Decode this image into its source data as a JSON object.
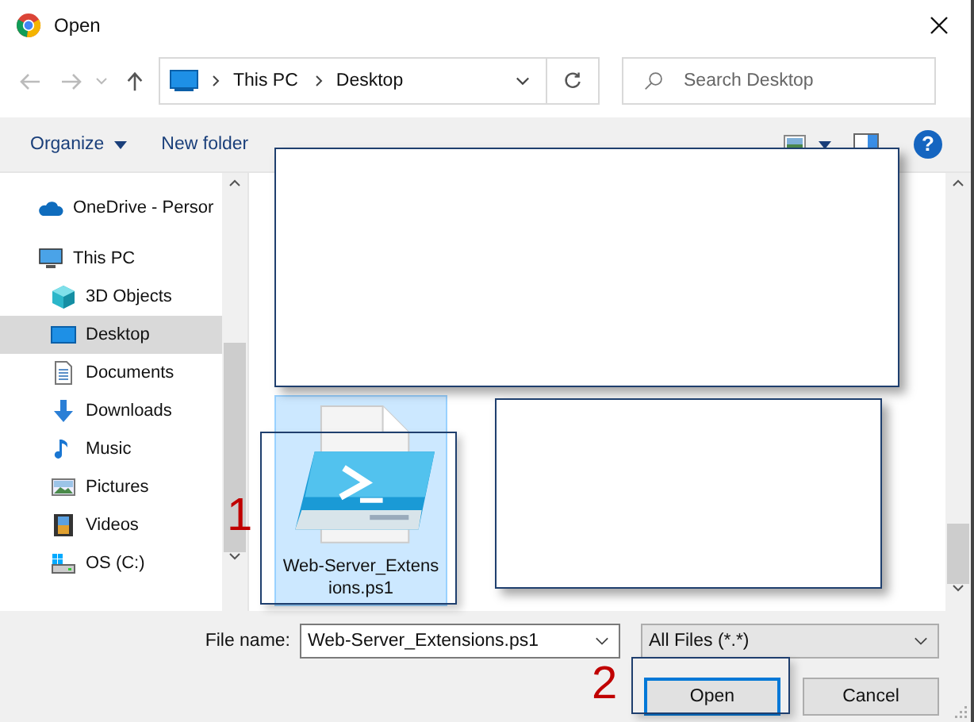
{
  "window": {
    "title": "Open"
  },
  "nav": {
    "path": [
      "This PC",
      "Desktop"
    ],
    "search": {
      "placeholder": "Search Desktop"
    }
  },
  "toolbar": {
    "organize": "Organize",
    "new_folder": "New folder",
    "help": "?"
  },
  "sidebar": {
    "items": [
      {
        "label": "OneDrive - Persor",
        "selected": false
      },
      {
        "label": "This PC",
        "selected": false,
        "children": [
          {
            "label": "3D Objects",
            "selected": false
          },
          {
            "label": "Desktop",
            "selected": true
          },
          {
            "label": "Documents",
            "selected": false
          },
          {
            "label": "Downloads",
            "selected": false
          },
          {
            "label": "Music",
            "selected": false
          },
          {
            "label": "Pictures",
            "selected": false
          },
          {
            "label": "Videos",
            "selected": false
          },
          {
            "label": "OS (C:)",
            "selected": false
          }
        ]
      }
    ]
  },
  "files": [
    {
      "name": "Web-Server_Extensions.ps1",
      "selected": true
    }
  ],
  "bottom": {
    "file_name_label": "File name:",
    "file_name": "Web-Server_Extensions.ps1",
    "filter": "All Files (*.*)",
    "buttons": [
      "Open",
      "Cancel"
    ]
  },
  "annotations": [
    "1",
    "2"
  ]
}
